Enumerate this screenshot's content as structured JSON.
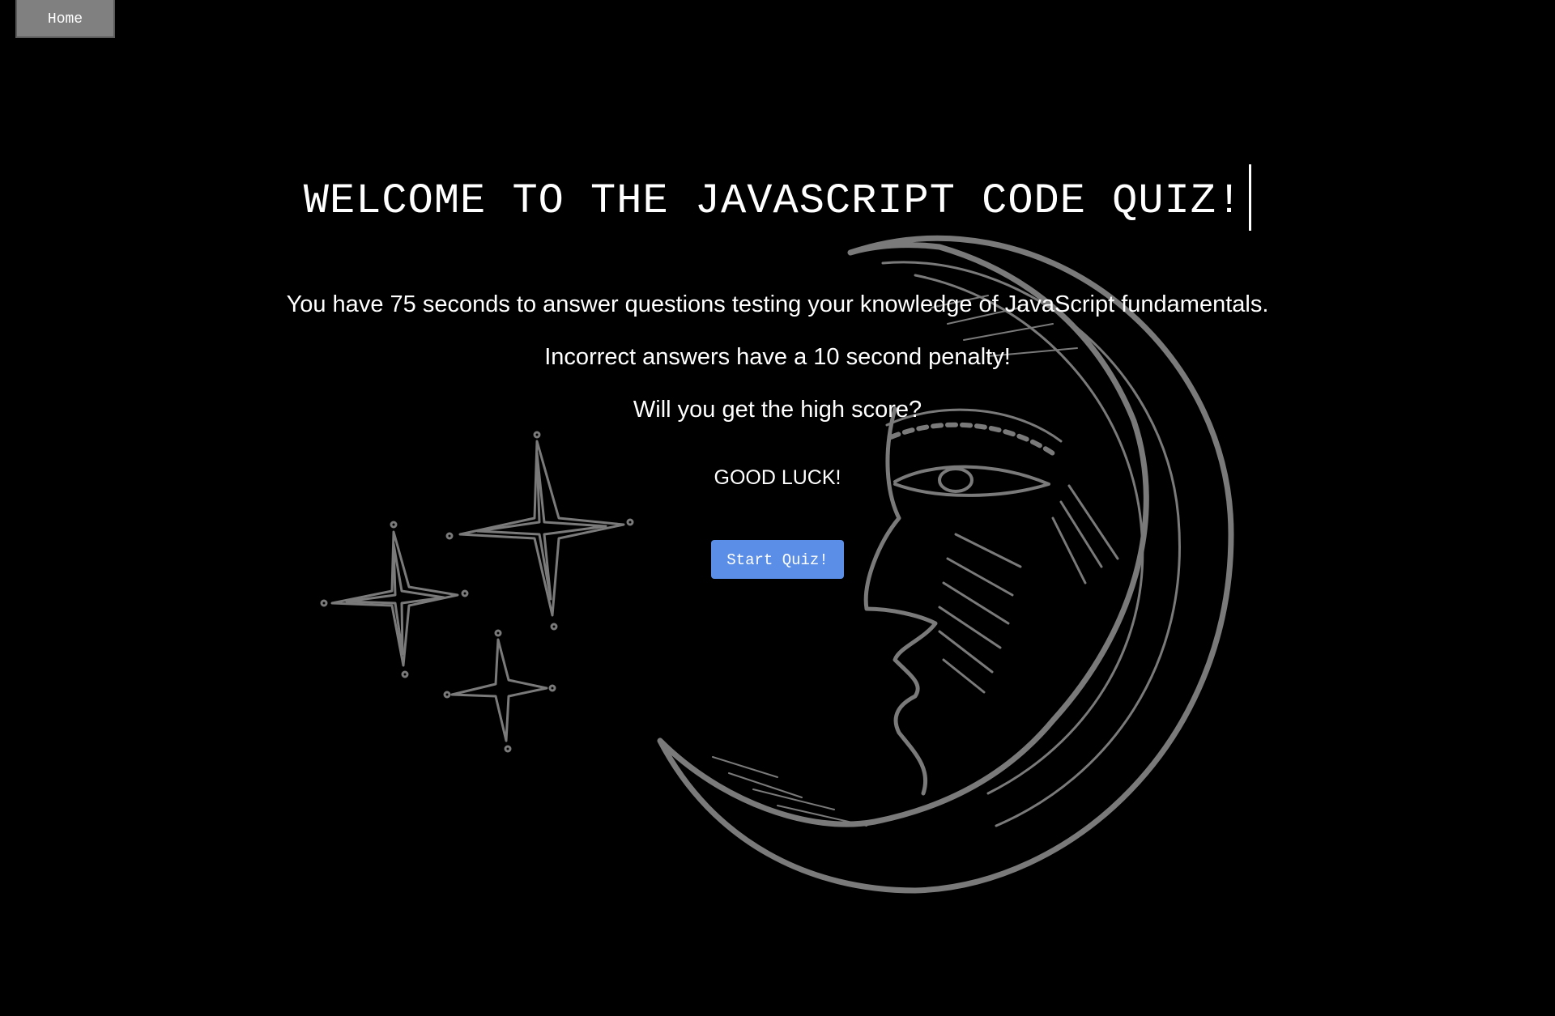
{
  "nav": {
    "home_label": "Home"
  },
  "intro": {
    "title": "WELCOME TO THE JAVASCRIPT CODE QUIZ!",
    "line1": "You have 75 seconds to answer questions testing your knowledge of JavaScript fundamentals.",
    "line2": "Incorrect answers have a 10 second penalty!",
    "line3": "Will you get the high score?",
    "good_luck": "GOOD LUCK!",
    "start_label": "Start Quiz!"
  },
  "illustration": {
    "icons": [
      "crescent-moon-face-icon",
      "star-icon"
    ]
  },
  "colors": {
    "background": "#000000",
    "text": "#ffffff",
    "home_button": "#808080",
    "start_button": "#5b8ee6",
    "illustration": "#7a7a7a"
  }
}
